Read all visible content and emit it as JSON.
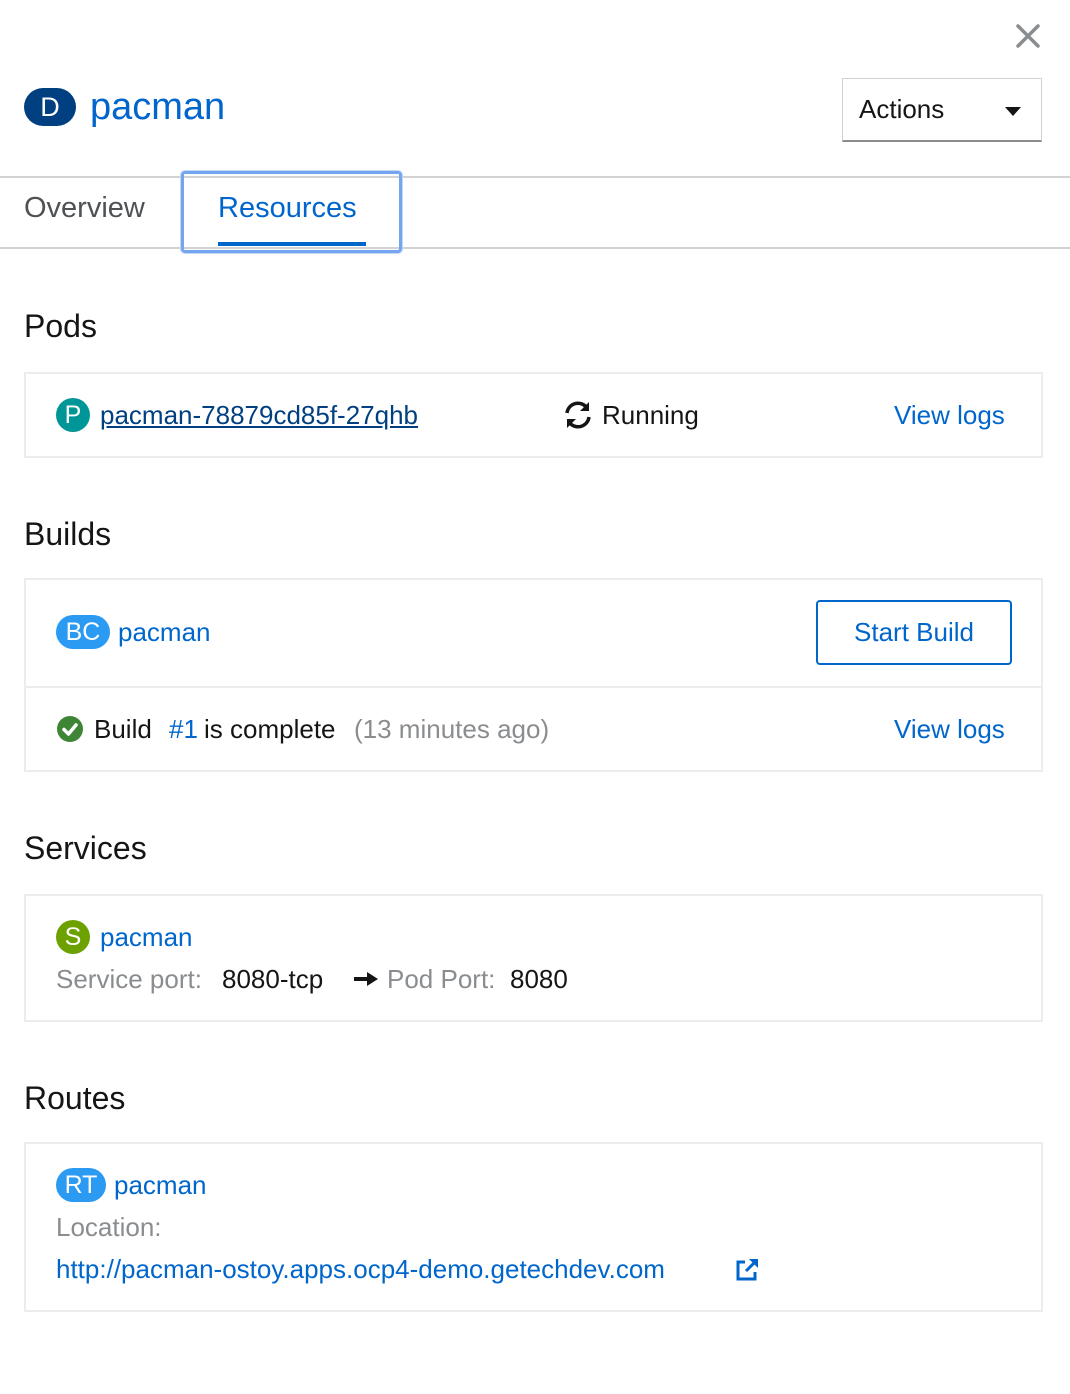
{
  "header": {
    "badge": "D",
    "title": "pacman",
    "actions_label": "Actions"
  },
  "tabs": [
    {
      "label": "Overview",
      "active": false
    },
    {
      "label": "Resources",
      "active": true
    }
  ],
  "pods": {
    "heading": "Pods",
    "badge": "P",
    "name": "pacman-78879cd85f-27qhb",
    "status": "Running",
    "logs_label": "View logs"
  },
  "builds": {
    "heading": "Builds",
    "badge": "BC",
    "name": "pacman",
    "start_label": "Start Build",
    "build_word": "Build",
    "build_number": "#1",
    "build_state": "is complete",
    "build_age": "(13 minutes ago)",
    "logs_label": "View logs"
  },
  "services": {
    "heading": "Services",
    "badge": "S",
    "name": "pacman",
    "service_port_label": "Service port:",
    "service_port_value": "8080-tcp",
    "pod_port_label": "Pod Port:",
    "pod_port_value": "8080"
  },
  "routes": {
    "heading": "Routes",
    "badge": "RT",
    "name": "pacman",
    "location_label": "Location:",
    "url": "http://pacman-ostoy.apps.ocp4-demo.getechdev.com"
  },
  "colors": {
    "link": "#0066cc",
    "deployment_badge": "#004080",
    "pod_badge": "#009596",
    "buildconfig_badge": "#2b9af3",
    "service_badge": "#6ca100",
    "route_badge": "#2b9af3",
    "success": "#3e8635"
  }
}
